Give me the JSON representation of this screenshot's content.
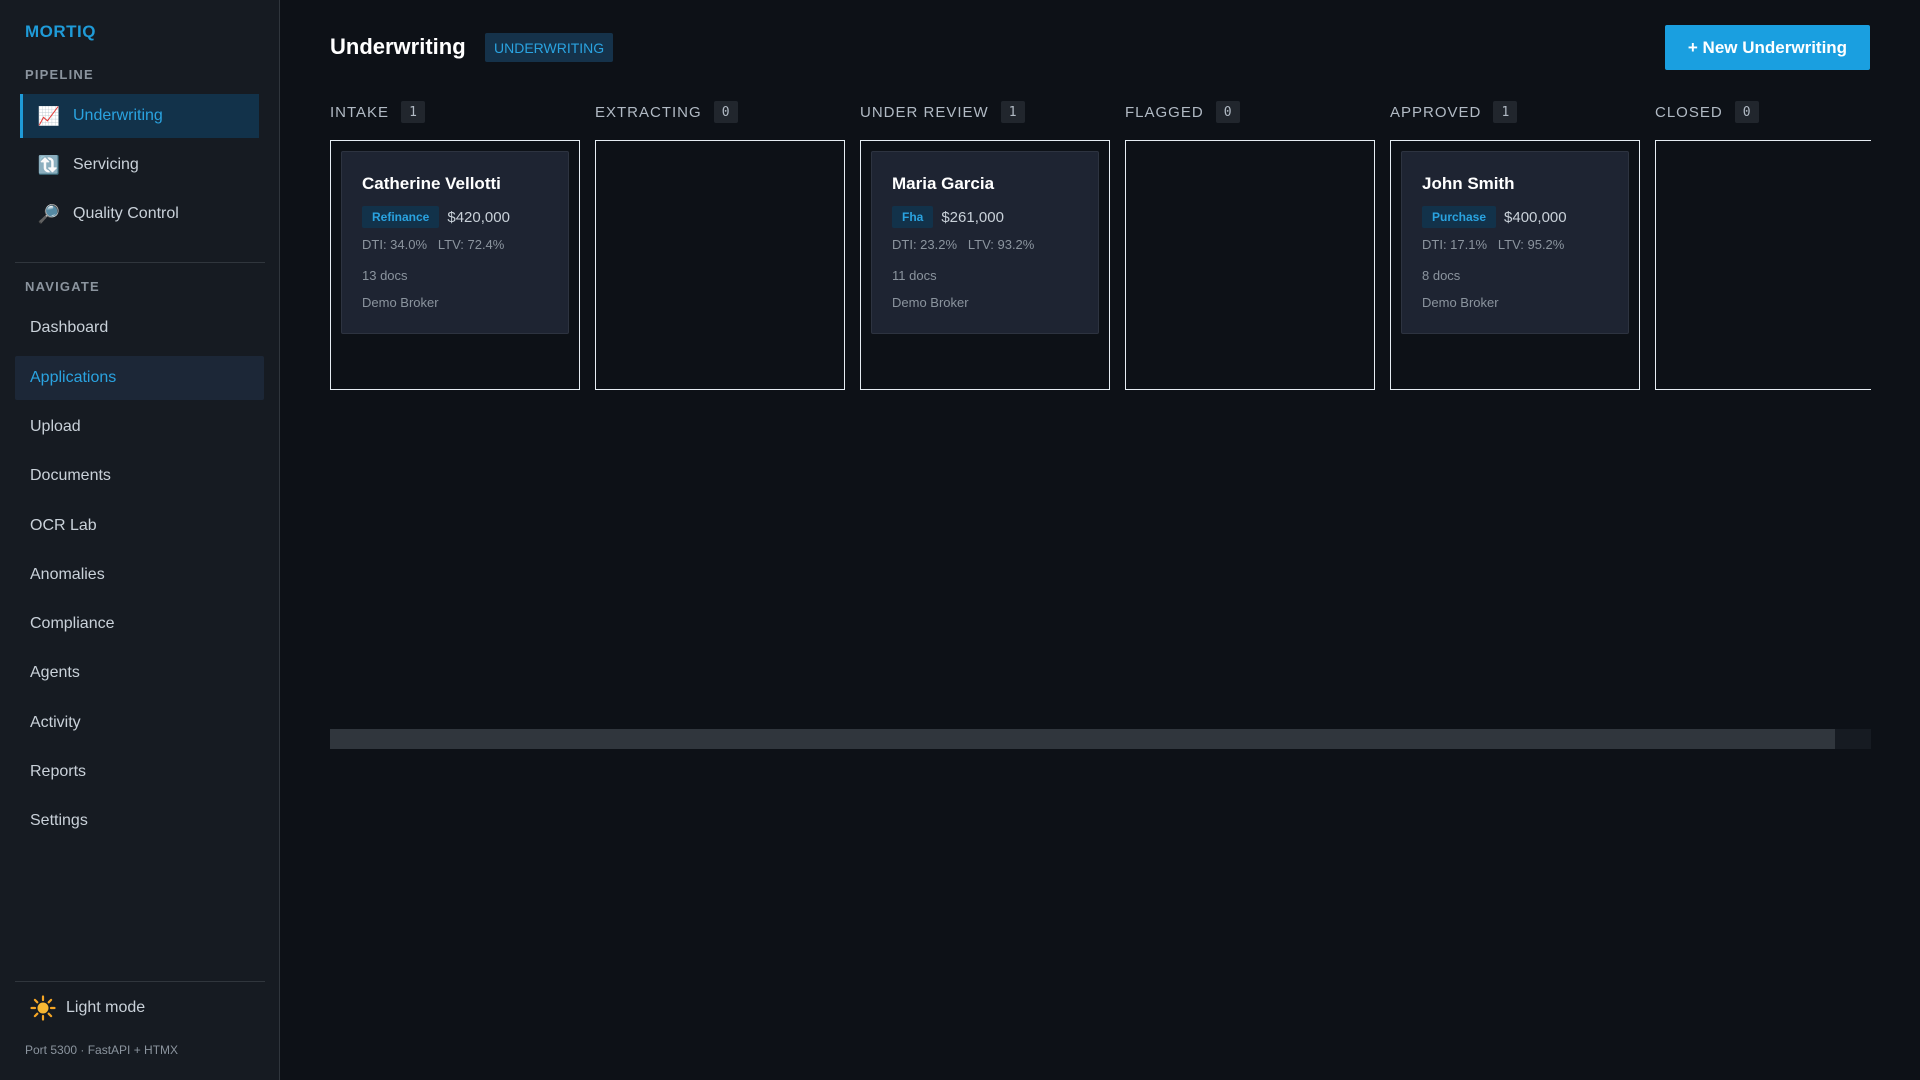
{
  "app": {
    "brand": "MORTIQ"
  },
  "sidebar": {
    "pipeline_label": "PIPELINE",
    "pipeline_items": [
      {
        "label": "Underwriting",
        "icon": "chart-increasing-icon",
        "glyph": "📈",
        "active": true
      },
      {
        "label": "Servicing",
        "icon": "refresh-icon",
        "glyph": "🔃",
        "active": false
      },
      {
        "label": "Quality Control",
        "icon": "magnifier-icon",
        "glyph": "🔎",
        "active": false
      }
    ],
    "navigate_label": "NAVIGATE",
    "nav_items": [
      {
        "label": "Dashboard",
        "active": false
      },
      {
        "label": "Applications",
        "active": true
      },
      {
        "label": "Upload",
        "active": false
      },
      {
        "label": "Documents",
        "active": false
      },
      {
        "label": "OCR Lab",
        "active": false
      },
      {
        "label": "Anomalies",
        "active": false
      },
      {
        "label": "Compliance",
        "active": false
      },
      {
        "label": "Agents",
        "active": false
      },
      {
        "label": "Activity",
        "active": false
      },
      {
        "label": "Reports",
        "active": false
      },
      {
        "label": "Settings",
        "active": false
      }
    ],
    "theme_toggle_label": "Light mode",
    "footer": "Port 5300 · FastAPI + HTMX"
  },
  "header": {
    "title": "Underwriting",
    "badge": "UNDERWRITING",
    "new_button": "+ New Underwriting"
  },
  "colors": {
    "accent": "#1a9fe0",
    "background": "#0d1117",
    "sidebar": "#161b22",
    "card": "#1e2432"
  },
  "board": {
    "columns": [
      {
        "title": "INTAKE",
        "count": "1",
        "cards": [
          {
            "name": "Catherine Vellotti",
            "type": "Refinance",
            "amount": "$420,000",
            "metrics": "DTI: 34.0%   LTV: 72.4%",
            "docs": "13 docs",
            "broker": "Demo Broker"
          }
        ]
      },
      {
        "title": "EXTRACTING",
        "count": "0",
        "cards": []
      },
      {
        "title": "UNDER REVIEW",
        "count": "1",
        "cards": [
          {
            "name": "Maria Garcia",
            "type": "Fha",
            "amount": "$261,000",
            "metrics": "DTI: 23.2%   LTV: 93.2%",
            "docs": "11 docs",
            "broker": "Demo Broker"
          }
        ]
      },
      {
        "title": "FLAGGED",
        "count": "0",
        "cards": []
      },
      {
        "title": "APPROVED",
        "count": "1",
        "cards": [
          {
            "name": "John Smith",
            "type": "Purchase",
            "amount": "$400,000",
            "metrics": "DTI: 17.1%   LTV: 95.2%",
            "docs": "8 docs",
            "broker": "Demo Broker"
          }
        ]
      },
      {
        "title": "CLOSED",
        "count": "0",
        "cards": []
      }
    ]
  }
}
